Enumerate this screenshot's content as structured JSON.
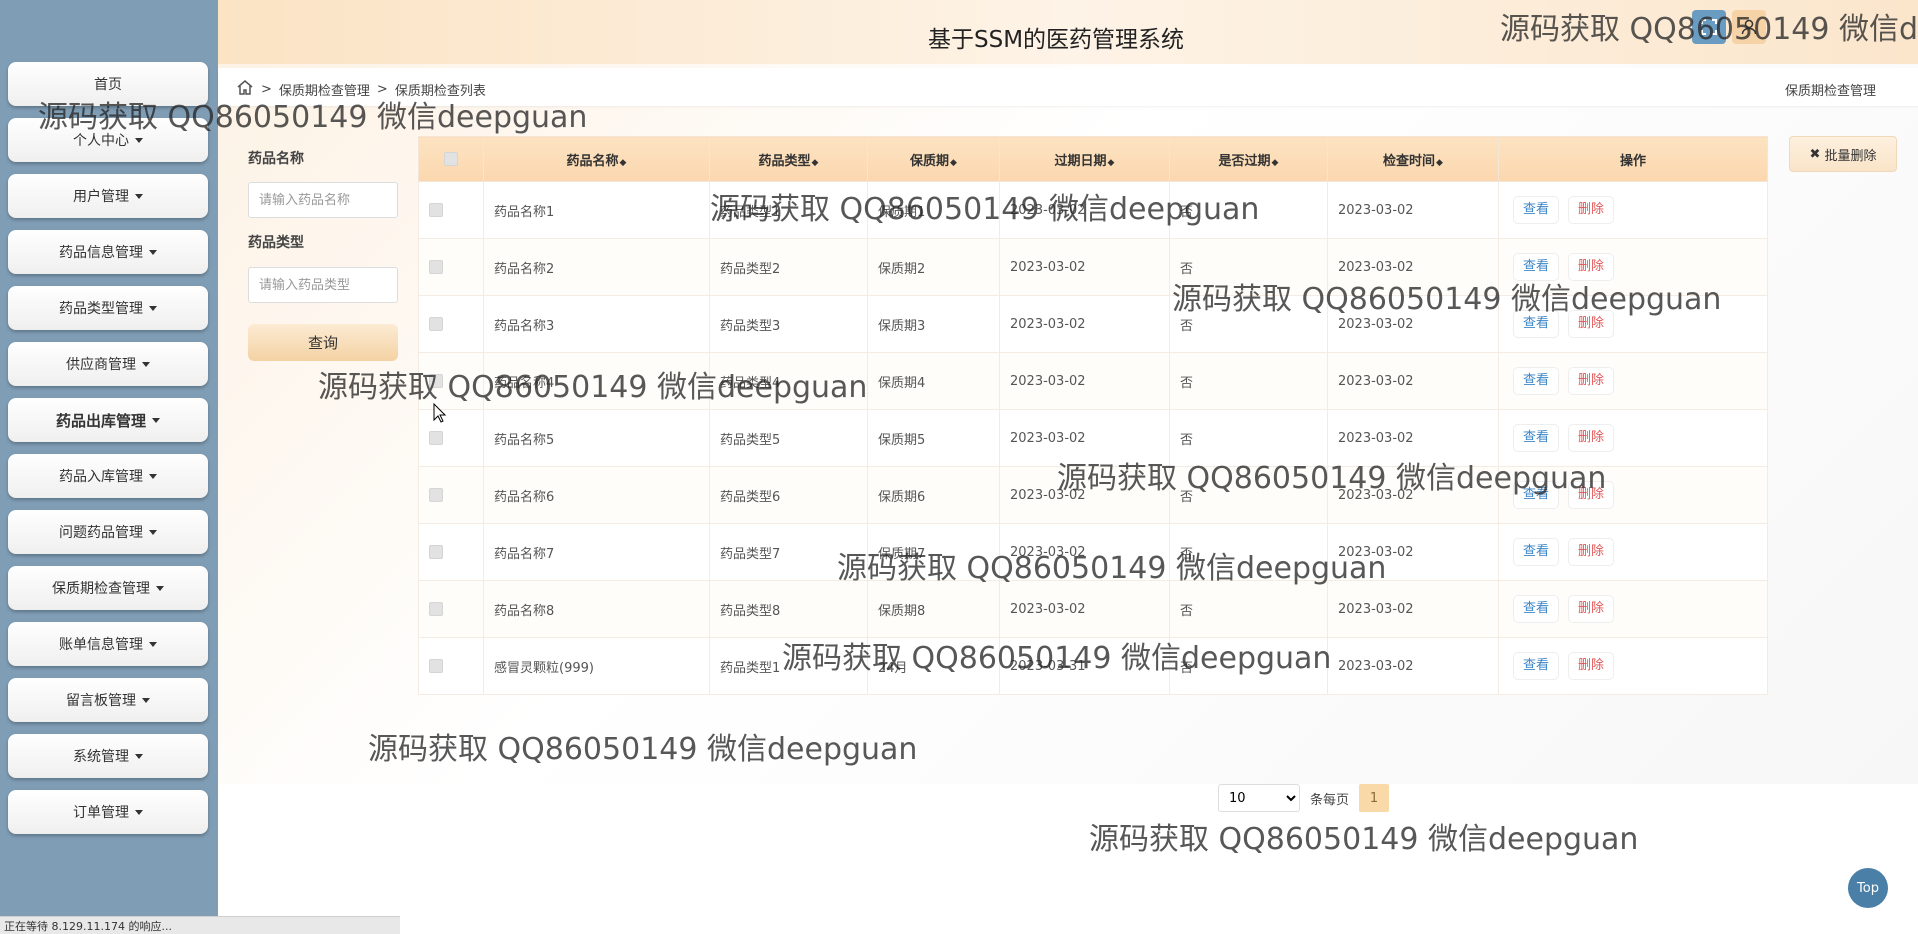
{
  "header": {
    "title": "基于SSM的医药管理系统"
  },
  "sidebar": {
    "items": [
      {
        "label": "首页",
        "caret": false,
        "bold": false
      },
      {
        "label": "个人中心",
        "caret": true,
        "bold": false
      },
      {
        "label": "用户管理",
        "caret": true,
        "bold": false
      },
      {
        "label": "药品信息管理",
        "caret": true,
        "bold": false
      },
      {
        "label": "药品类型管理",
        "caret": true,
        "bold": false
      },
      {
        "label": "供应商管理",
        "caret": true,
        "bold": false
      },
      {
        "label": "药品出库管理",
        "caret": true,
        "bold": true
      },
      {
        "label": "药品入库管理",
        "caret": true,
        "bold": false
      },
      {
        "label": "问题药品管理",
        "caret": true,
        "bold": false
      },
      {
        "label": "保质期检查管理",
        "caret": true,
        "bold": false
      },
      {
        "label": "账单信息管理",
        "caret": true,
        "bold": false
      },
      {
        "label": "留言板管理",
        "caret": true,
        "bold": false
      },
      {
        "label": "系统管理",
        "caret": true,
        "bold": false
      },
      {
        "label": "订单管理",
        "caret": true,
        "bold": false
      }
    ]
  },
  "breadcrumb": {
    "items": [
      "保质期检查管理",
      "保质期检查列表"
    ],
    "separator": ">",
    "right": "保质期检查管理"
  },
  "filters": {
    "name_label": "药品名称",
    "name_placeholder": "请输入药品名称",
    "type_label": "药品类型",
    "type_placeholder": "请输入药品类型",
    "query_label": "查询"
  },
  "batch_delete_label": "批量删除",
  "table": {
    "columns": [
      {
        "label": "药品名称",
        "sortable": true
      },
      {
        "label": "药品类型",
        "sortable": true
      },
      {
        "label": "保质期",
        "sortable": true
      },
      {
        "label": "过期日期",
        "sortable": true
      },
      {
        "label": "是否过期",
        "sortable": true
      },
      {
        "label": "检查时间",
        "sortable": true
      },
      {
        "label": "操作",
        "sortable": false
      }
    ],
    "sort_glyph": "◆",
    "view_label": "查看",
    "delete_label": "删除",
    "rows": [
      [
        "药品名称1",
        "药品类型1",
        "保质期1",
        "2023-03-02",
        "否",
        "2023-03-02"
      ],
      [
        "药品名称2",
        "药品类型2",
        "保质期2",
        "2023-03-02",
        "否",
        "2023-03-02"
      ],
      [
        "药品名称3",
        "药品类型3",
        "保质期3",
        "2023-03-02",
        "否",
        "2023-03-02"
      ],
      [
        "药品名称4",
        "药品类型4",
        "保质期4",
        "2023-03-02",
        "否",
        "2023-03-02"
      ],
      [
        "药品名称5",
        "药品类型5",
        "保质期5",
        "2023-03-02",
        "否",
        "2023-03-02"
      ],
      [
        "药品名称6",
        "药品类型6",
        "保质期6",
        "2023-03-02",
        "否",
        "2023-03-02"
      ],
      [
        "药品名称7",
        "药品类型7",
        "保质期7",
        "2023-03-02",
        "否",
        "2023-03-02"
      ],
      [
        "药品名称8",
        "药品类型8",
        "保质期8",
        "2023-03-02",
        "否",
        "2023-03-02"
      ],
      [
        "感冒灵颗粒(999)",
        "药品类型1",
        "24月",
        "2023-03-31",
        "否",
        "2023-03-02"
      ]
    ]
  },
  "pagination": {
    "page_size": "10",
    "page_size_options": [
      "10"
    ],
    "per_page_label": "条每页",
    "current_page": "1"
  },
  "top_button_label": "Top",
  "status_text": "正在等待 8.129.11.174 的响应...",
  "watermark_text": "源码获取 QQ86050149 微信deepguan",
  "colors": {
    "sidebar": "#7f9db5",
    "accent": "#fbd7ae",
    "view": "#3d86c6",
    "delete": "#e05656"
  }
}
